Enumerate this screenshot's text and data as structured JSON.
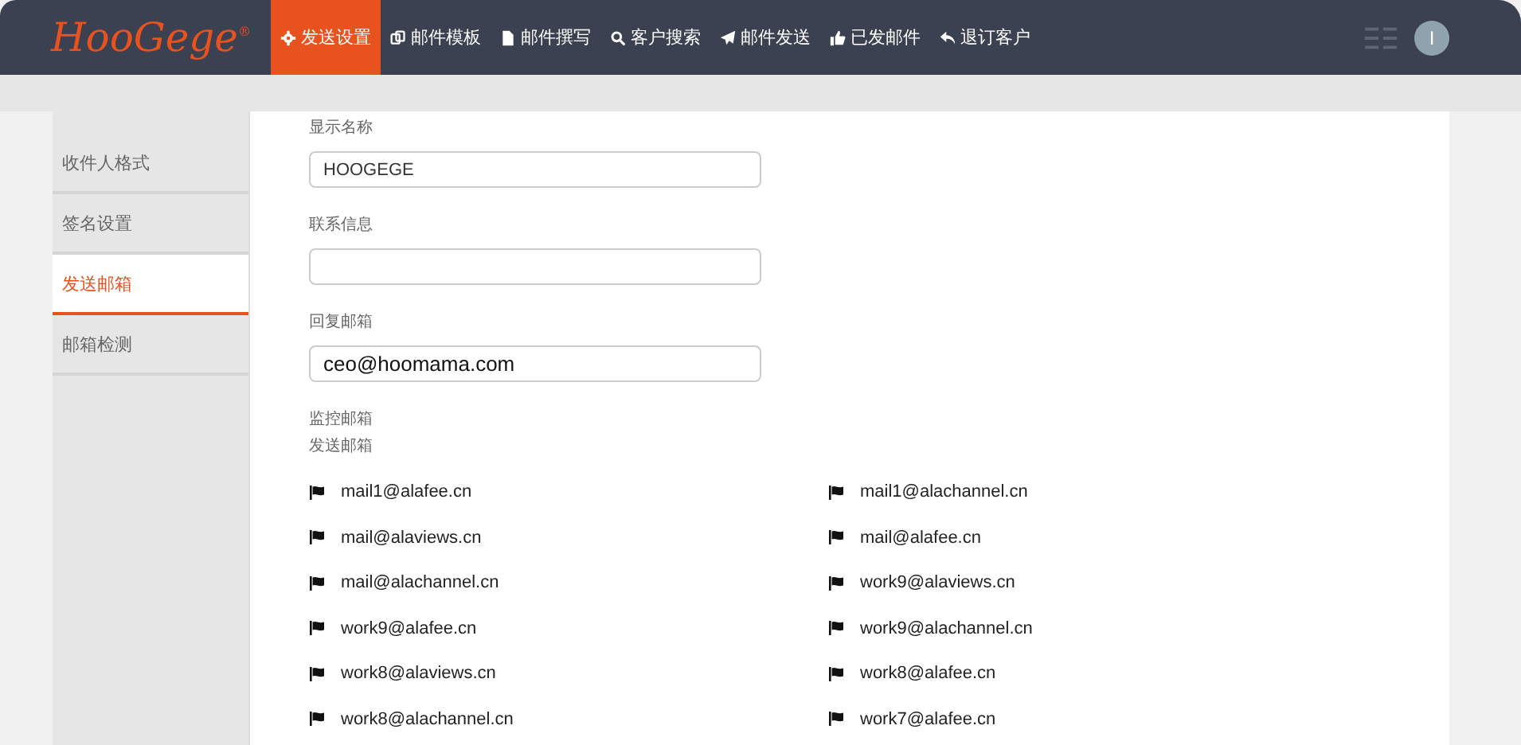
{
  "logo": "HooGege$^{®}$",
  "nav": [
    {
      "label": "发送设置",
      "kind": "gear",
      "selected": true
    },
    {
      "label": "邮件模板",
      "kind": "copy",
      "selected": false
    },
    {
      "label": "邮件撰写",
      "kind": "file",
      "selected": false
    },
    {
      "label": "客户搜索",
      "kind": "search",
      "selected": false
    },
    {
      "label": "邮件发送",
      "kind": "send",
      "selected": false
    },
    {
      "label": "已发邮件",
      "kind": "thumb",
      "selected": false
    },
    {
      "label": "退订客户",
      "kind": "reply",
      "selected": false
    }
  ],
  "avatar": "I",
  "sidebar": [
    {
      "label": "收件人格式",
      "selected": false
    },
    {
      "label": "签名设置",
      "selected": false
    },
    {
      "label": "发送邮箱",
      "selected": true
    },
    {
      "label": "邮箱检测",
      "selected": false
    }
  ],
  "fields": [
    {
      "label": "显示名称",
      "value": "HOOGEGE"
    },
    {
      "label": "联系信息"
    },
    {
      "label": "回复邮箱",
      "value": "ceo@hoomama.com"
    }
  ],
  "monitor_label": "监控邮箱",
  "send_label": "发送邮箱",
  "mailboxes": [
    "mail1@alafee.cn",
    "mail1@alachannel.cn",
    "mail@alaviews.cn",
    "mail@alafee.cn",
    "mail@alachannel.cn",
    "work9@alaviews.cn",
    "work9@alafee.cn",
    "work9@alachannel.cn",
    "work8@alaviews.cn",
    "work8@alafee.cn",
    "work8@alachannel.cn",
    "work7@alafee.cn"
  ]
}
